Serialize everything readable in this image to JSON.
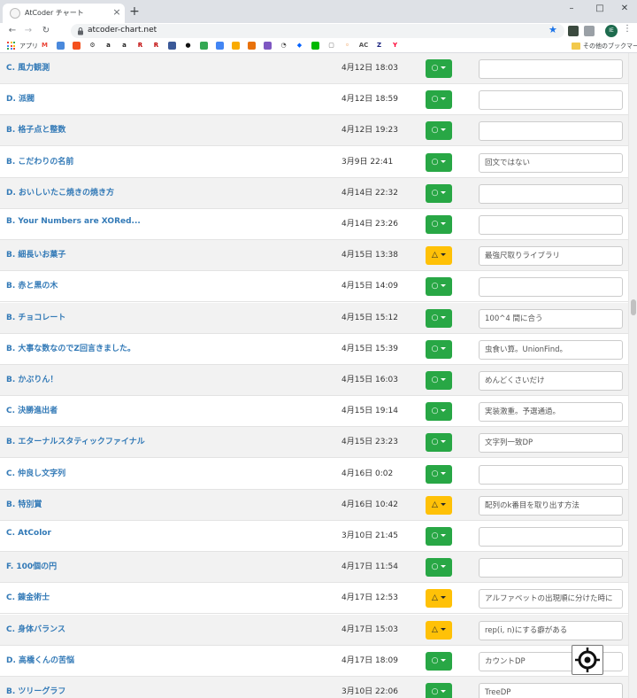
{
  "browser": {
    "tab_title": "AtCoder チャート",
    "tab_close": "×",
    "new_tab": "+",
    "window_controls": {
      "minimize": "–",
      "maximize": "□",
      "close": "✕"
    },
    "url": "atcoder-chart.net",
    "profile_initials": "IE",
    "bookmarks": {
      "apps_label": "アプリ",
      "other_label": "その他のブックマーク"
    }
  },
  "colors": {
    "ok": "#28a745",
    "warn": "#ffc107",
    "link": "#337ab7"
  },
  "status_symbols": {
    "ok": "○",
    "warn": "△"
  },
  "rows": [
    {
      "name": "C. 風力観測",
      "date": "4月12日 18:03",
      "status": "ok",
      "memo": ""
    },
    {
      "name": "D. 派閥",
      "date": "4月12日 18:59",
      "status": "ok",
      "memo": ""
    },
    {
      "name": "B. 格子点と整数",
      "date": "4月12日 19:23",
      "status": "ok",
      "memo": ""
    },
    {
      "name": "B. こだわりの名前",
      "date": "3月9日 22:41",
      "status": "ok",
      "memo": "回文ではない"
    },
    {
      "name": "D. おいしいたこ焼きの焼き方",
      "date": "4月14日 22:32",
      "status": "ok",
      "memo": ""
    },
    {
      "name": "B. Your Numbers are XORed...",
      "date": "4月14日 23:26",
      "status": "ok",
      "memo": ""
    },
    {
      "name": "B. 細長いお菓子",
      "date": "4月15日 13:38",
      "status": "warn",
      "memo": "最強尺取りライブラリ"
    },
    {
      "name": "B. 赤と黒の木",
      "date": "4月15日 14:09",
      "status": "ok",
      "memo": ""
    },
    {
      "name": "B. チョコレート",
      "date": "4月15日 15:12",
      "status": "ok",
      "memo": "100^4 間に合う"
    },
    {
      "name": "B. 大事な数なのでZ回言きました。",
      "date": "4月15日 15:39",
      "status": "ok",
      "memo": "虫食い算。UnionFind。"
    },
    {
      "name": "B. かぶりん！",
      "date": "4月15日 16:03",
      "status": "ok",
      "memo": "めんどくさいだけ"
    },
    {
      "name": "C. 決勝進出者",
      "date": "4月15日 19:14",
      "status": "ok",
      "memo": "実装激重。予選通過。"
    },
    {
      "name": "B. エターナルスタティックファイナル",
      "date": "4月15日 23:23",
      "status": "ok",
      "memo": "文字列一致DP"
    },
    {
      "name": "C. 仲良し文字列",
      "date": "4月16日 0:02",
      "status": "ok",
      "memo": ""
    },
    {
      "name": "B. 特別賞",
      "date": "4月16日 10:42",
      "status": "warn",
      "memo": "配列のk番目を取り出す方法"
    },
    {
      "name": "C. AtColor",
      "date": "3月10日 21:45",
      "status": "ok",
      "memo": ""
    },
    {
      "name": "F. 100個の円",
      "date": "4月17日 11:54",
      "status": "ok",
      "memo": ""
    },
    {
      "name": "C. 錬金術士",
      "date": "4月17日 12:53",
      "status": "warn",
      "memo": "アルファベットの出現順に分けた時に"
    },
    {
      "name": "C. 身体バランス",
      "date": "4月17日 15:03",
      "status": "warn",
      "memo": "rep(i, n)にする癖がある"
    },
    {
      "name": "D. 高橋くんの苦悩",
      "date": "4月17日 18:09",
      "status": "ok",
      "memo": "カウントDP"
    },
    {
      "name": "B. ツリーグラフ",
      "date": "3月10日 22:06",
      "status": "ok",
      "memo": "TreeDP"
    }
  ]
}
